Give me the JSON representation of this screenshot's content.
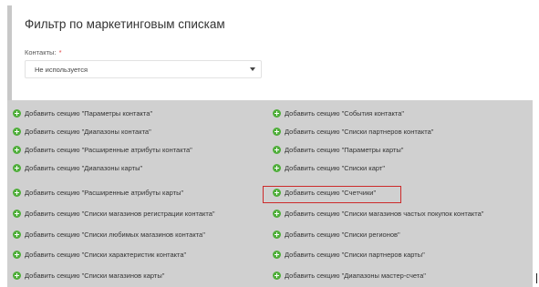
{
  "filter": {
    "title": "Фильтр по маркетинговым спискам",
    "contacts_label": "Контакты:",
    "required_mark": "*",
    "contacts_value": "Не используется"
  },
  "sections": {
    "left": [
      "Добавить секцию \"Параметры контакта\"",
      "Добавить секцию \"Диапазоны контакта\"",
      "Добавить секцию \"Расширенные атрибуты контакта\"",
      "Добавить секцию \"Диапазоны карты\"",
      "Добавить секцию \"Расширенные атрибуты карты\"",
      "Добавить секцию \"Списки магазинов регистрации контакта\"",
      "Добавить секцию \"Списки любимых магазинов контакта\"",
      "Добавить секцию \"Списки характеристик контакта\"",
      "Добавить секцию \"Списки магазинов карты\""
    ],
    "right": [
      "Добавить секцию \"События контакта\"",
      "Добавить секцию \"Списки партнеров контакта\"",
      "Добавить секцию \"Параметры карты\"",
      "Добавить секцию \"Списки карт\"",
      "Добавить секцию \"Счетчики\"",
      "Добавить секцию \"Списки магазинов частых покупок контакта\"",
      "Добавить секцию \"Списки регионов\"",
      "Добавить секцию \"Списки партнеров карты\"",
      "Добавить секцию \"Диапазоны мастер-счета\""
    ]
  },
  "colors": {
    "plus_icon": "#4fae3a",
    "highlight": "#cc2a2a",
    "panel_bg": "#d0d0d0"
  }
}
